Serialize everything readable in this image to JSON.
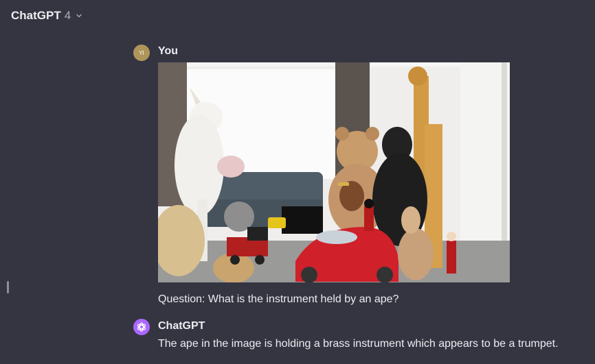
{
  "header": {
    "model_name": "ChatGPT",
    "model_version": "4"
  },
  "conversation": {
    "user": {
      "avatar_initials": "YI",
      "author": "You",
      "question": "Question: What is the instrument held by an ape?"
    },
    "assistant": {
      "author": "ChatGPT",
      "answer": "The ape in the image is holding a brass instrument which appears to be a trumpet."
    }
  },
  "colors": {
    "background": "#343541",
    "text": "#ececf1",
    "user_avatar": "#b0955a",
    "assistant_avatar": "#ab68ff"
  }
}
